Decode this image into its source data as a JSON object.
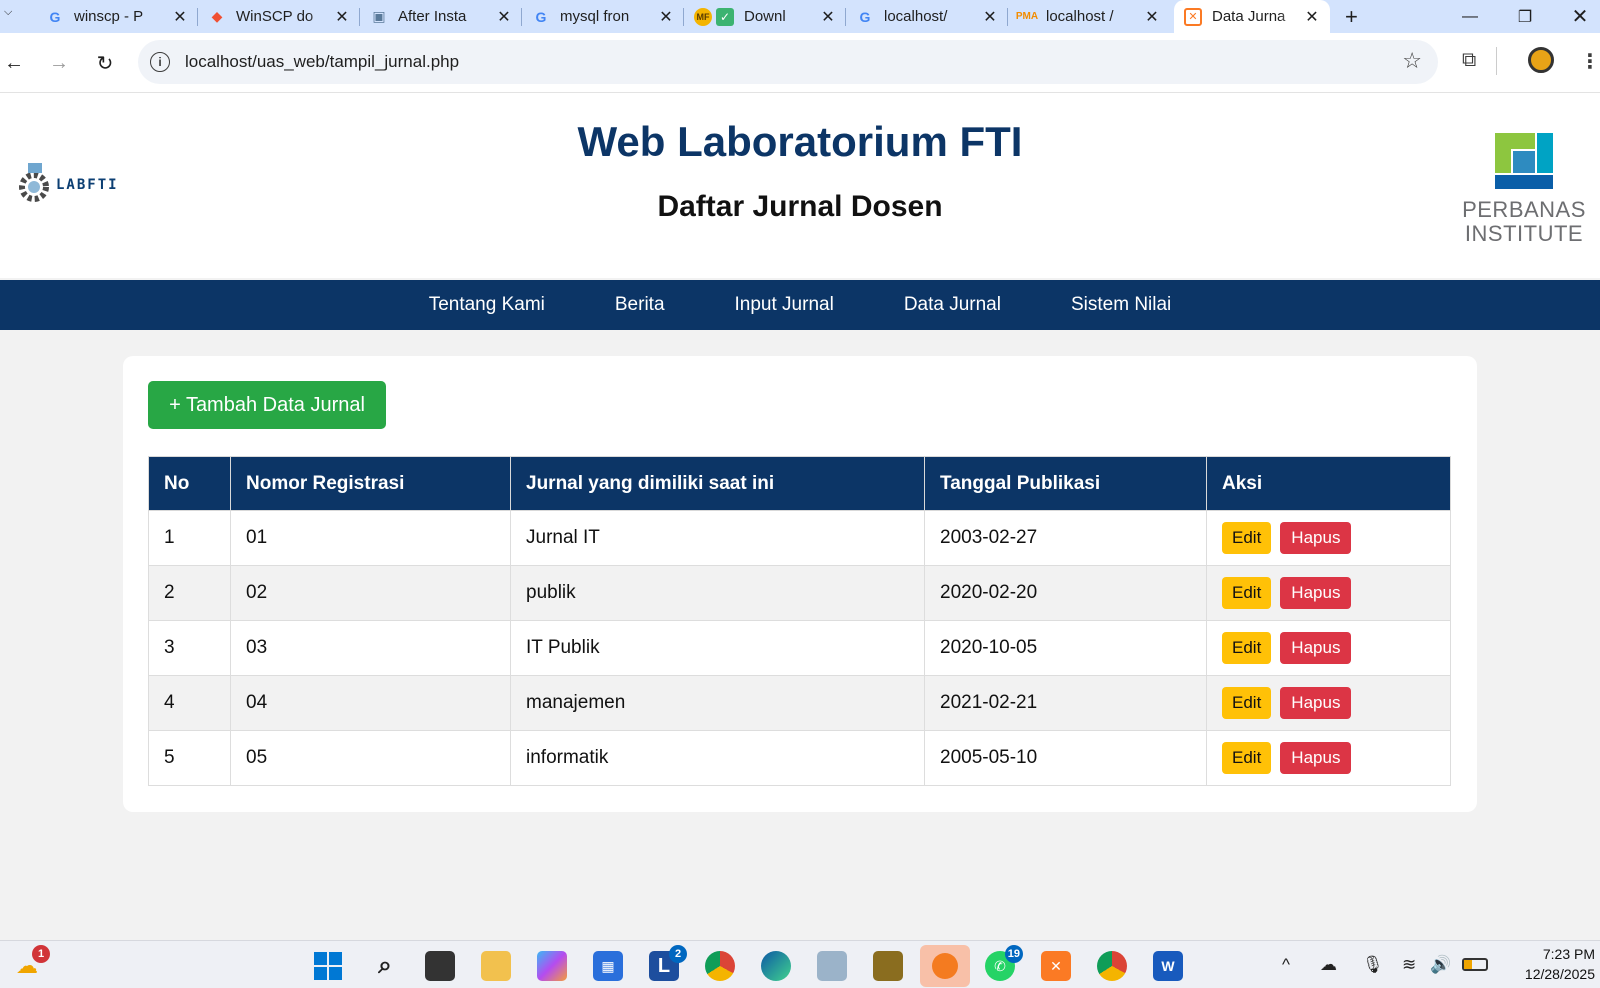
{
  "browser": {
    "tabs": [
      {
        "title": "winscp - P",
        "favicon": "google-icon"
      },
      {
        "title": "WinSCP do",
        "favicon": "git-icon"
      },
      {
        "title": "After Insta",
        "favicon": "setup-icon"
      },
      {
        "title": "mysql fron",
        "favicon": "google-icon"
      },
      {
        "title": "Downl",
        "favicon": "download-check-icon"
      },
      {
        "title": "localhost/",
        "favicon": "google-icon"
      },
      {
        "title": "localhost /",
        "favicon": "phpmyadmin-icon"
      },
      {
        "title": "Data Jurna",
        "favicon": "xampp-icon",
        "active": true
      }
    ],
    "url": "localhost/uas_web/tampil_jurnal.php"
  },
  "header": {
    "title": "Web Laboratorium FTI",
    "subtitle": "Daftar Jurnal Dosen",
    "logo_left_text": "LABFTI",
    "logo_right_line1": "PERBANAS",
    "logo_right_line2": "INSTITUTE"
  },
  "nav": {
    "items": [
      "Tentang Kami",
      "Berita",
      "Input Jurnal",
      "Data Jurnal",
      "Sistem Nilai"
    ]
  },
  "main": {
    "add_button": "+ Tambah Data Jurnal",
    "table": {
      "headers": [
        "No",
        "Nomor Registrasi",
        "Jurnal yang dimiliki saat ini",
        "Tanggal Publikasi",
        "Aksi"
      ],
      "rows": [
        {
          "no": "1",
          "reg": "01",
          "jurnal": "Jurnal IT",
          "tanggal": "2003-02-27"
        },
        {
          "no": "2",
          "reg": "02",
          "jurnal": "publik",
          "tanggal": "2020-02-20"
        },
        {
          "no": "3",
          "reg": "03",
          "jurnal": "IT Publik",
          "tanggal": "2020-10-05"
        },
        {
          "no": "4",
          "reg": "04",
          "jurnal": "manajemen",
          "tanggal": "2021-02-21"
        },
        {
          "no": "5",
          "reg": "05",
          "jurnal": "informatik",
          "tanggal": "2005-05-10"
        }
      ],
      "edit_label": "Edit",
      "delete_label": "Hapus"
    }
  },
  "taskbar": {
    "weather_badge": "1",
    "l_badge": "2",
    "whatsapp_badge": "19",
    "time": "7:23 PM",
    "date": "12/28/2025"
  },
  "colors": {
    "primary": "#0c3566",
    "add_button": "#28a745",
    "edit_button": "#ffc107",
    "delete_button": "#dc3545",
    "tabbar": "#d3e3fd"
  }
}
